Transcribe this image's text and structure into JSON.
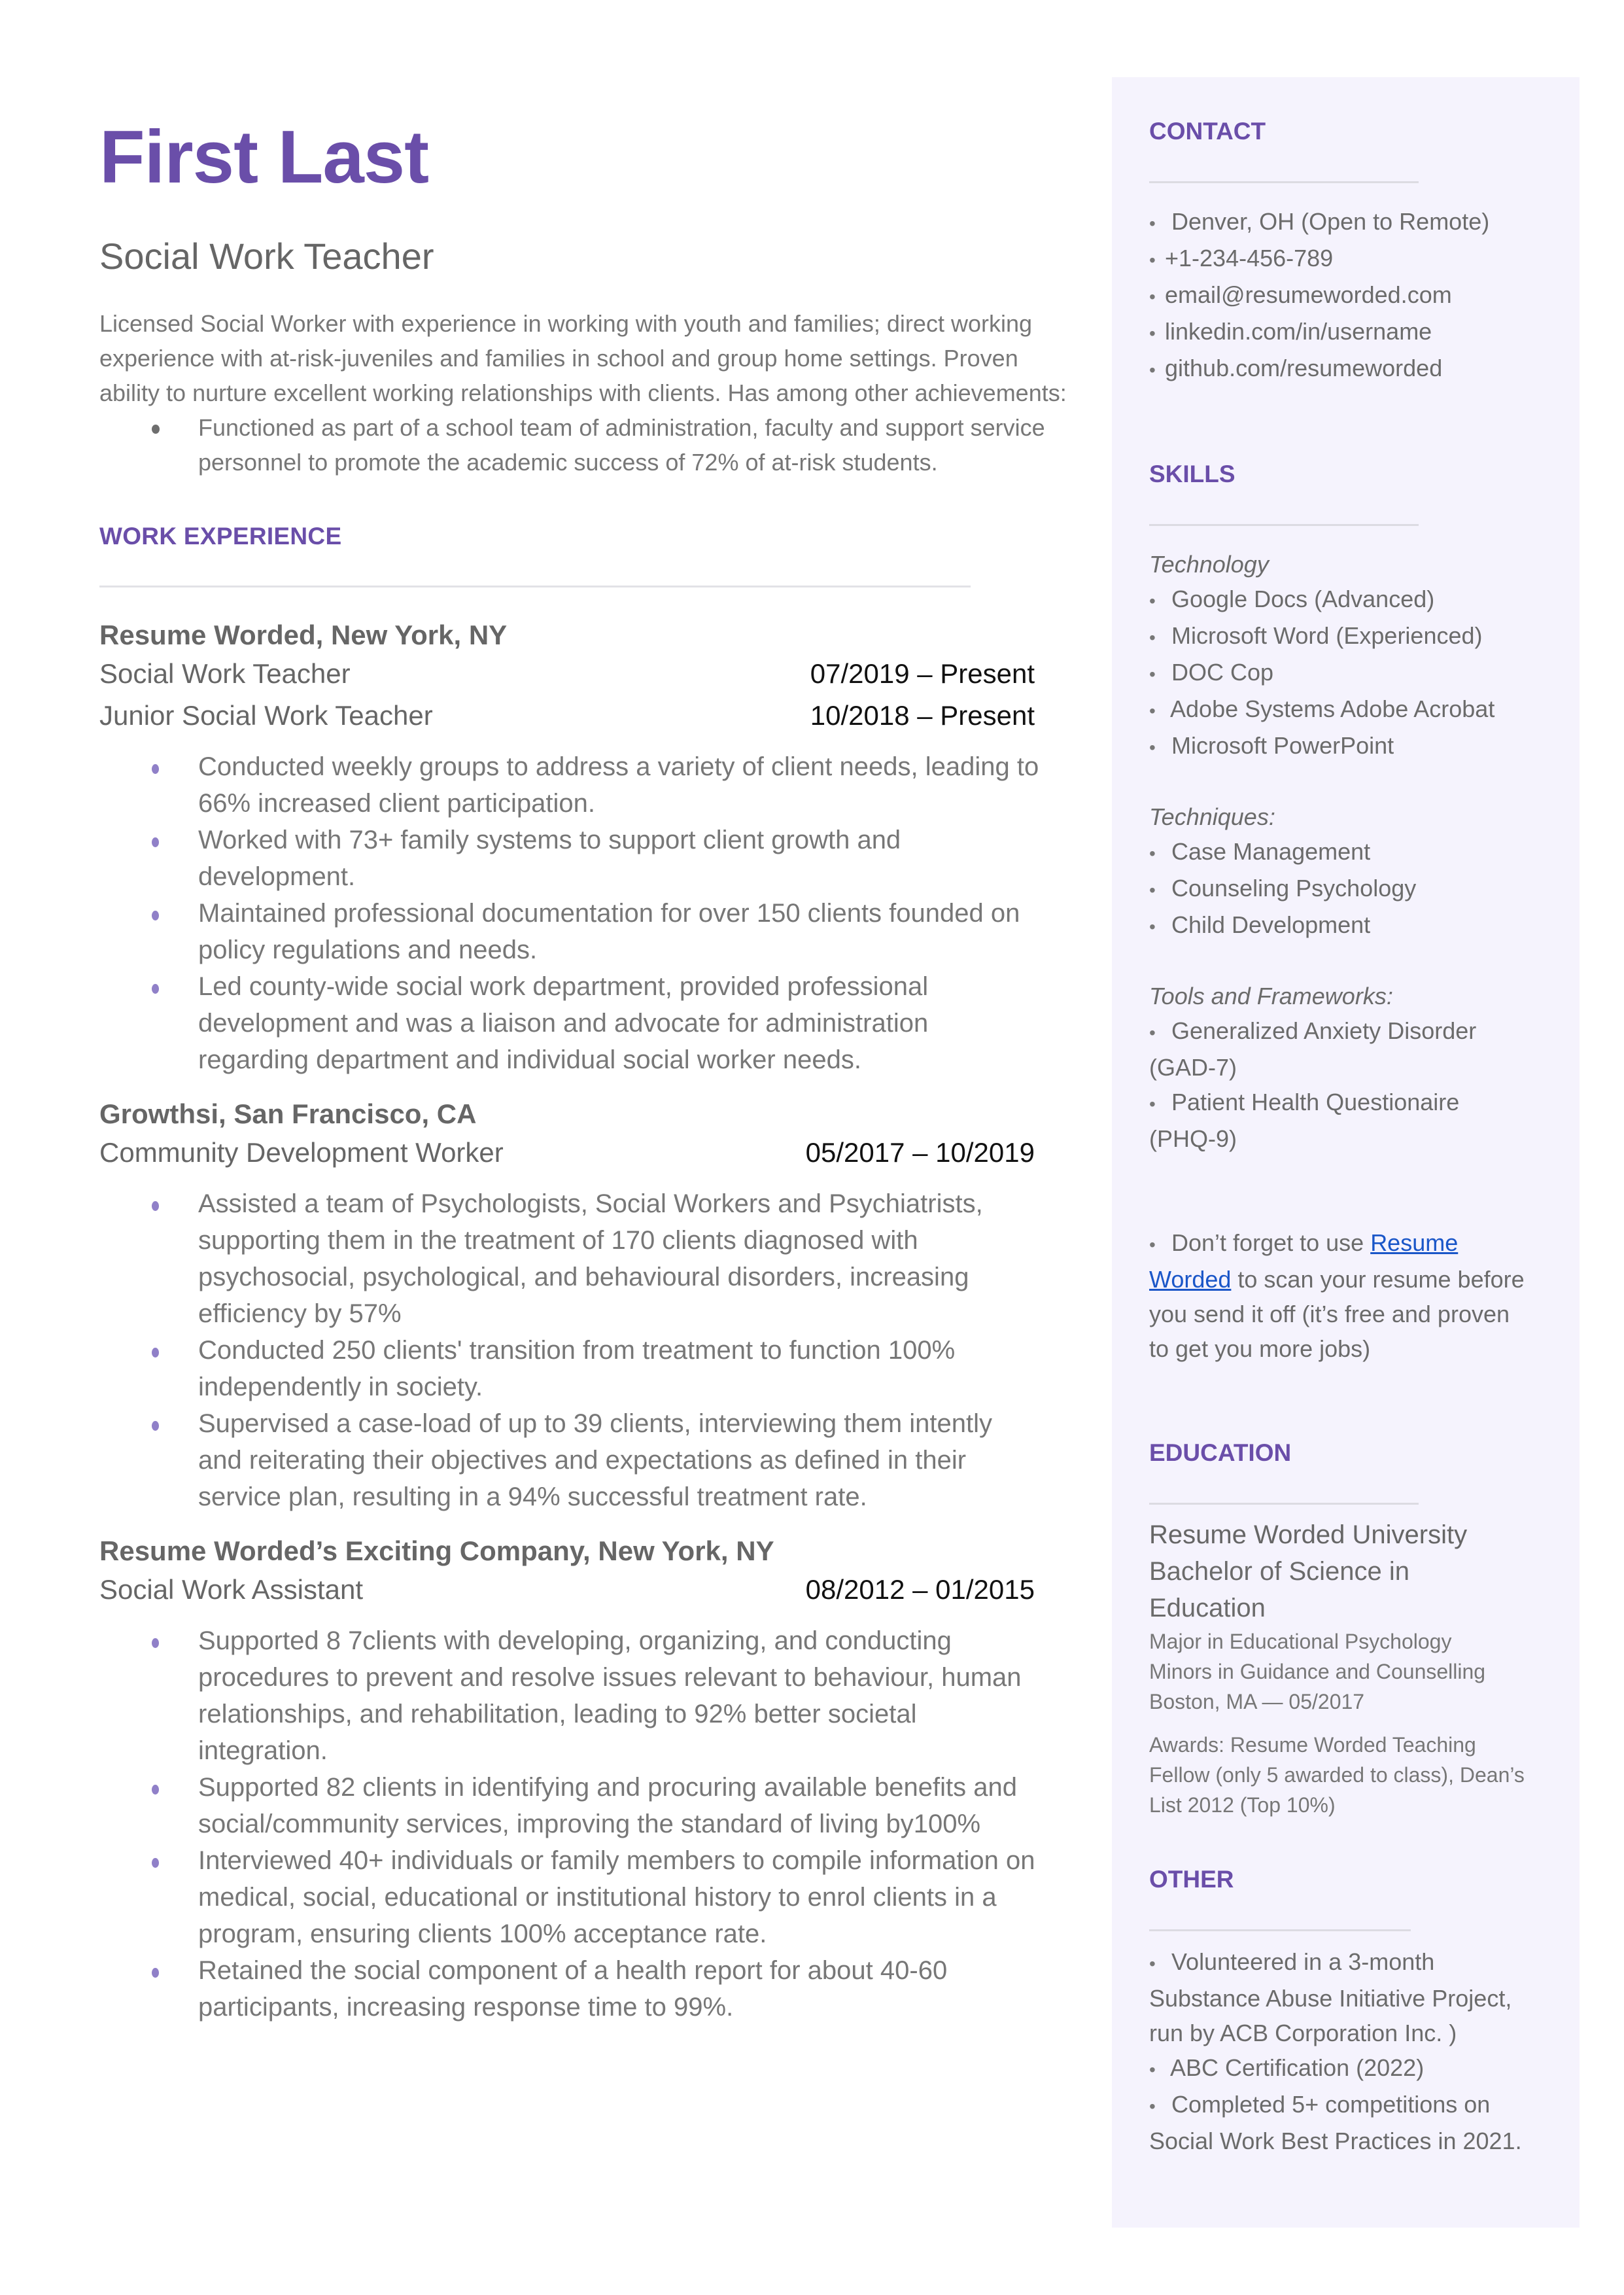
{
  "header": {
    "name": "First Last",
    "headline": "Social Work Teacher",
    "summary": "Licensed Social Worker with experience in working with youth and families; direct working experience with at-risk-juveniles and families in school and group home settings. Proven ability to nurture excellent working relationships with clients. Has among other achievements:",
    "summary_bullets": [
      "Functioned as part of a school team of administration, faculty and support service personnel to promote the academic success of 72% of at-risk students."
    ]
  },
  "work_experience": {
    "title": "WORK EXPERIENCE",
    "jobs": [
      {
        "company": "Resume Worded, New York, NY",
        "roles": [
          {
            "title": "Social Work Teacher",
            "dates": "07/2019 – Present"
          },
          {
            "title": "Junior Social Work Teacher",
            "dates": "10/2018 – Present"
          }
        ],
        "bullets": [
          "Conducted weekly groups to address a variety of client needs, leading to 66% increased client participation.",
          "Worked with 73+ family systems to support client growth and development.",
          "Maintained professional documentation for over 150 clients founded on policy regulations and needs.",
          "Led county-wide social work department, provided professional development and was a liaison and advocate for administration regarding department and individual social worker needs."
        ]
      },
      {
        "company": "Growthsi, San Francisco, CA",
        "roles": [
          {
            "title": "Community Development Worker",
            "dates": "05/2017 – 10/2019"
          }
        ],
        "bullets": [
          "Assisted a team of Psychologists, Social Workers and Psychiatrists, supporting them in the treatment of 170 clients diagnosed with psychosocial, psychological, and behavioural disorders, increasing efficiency by 57%",
          "Conducted 250 clients' transition from treatment to function 100% independently in society.",
          "Supervised a case-load of up to 39 clients, interviewing them intently and reiterating their objectives and expectations as defined in their service plan, resulting in a 94% successful treatment rate."
        ]
      },
      {
        "company": "Resume Worded’s Exciting Company, New York, NY",
        "roles": [
          {
            "title": "Social Work Assistant",
            "dates": "08/2012 – 01/2015"
          }
        ],
        "bullets": [
          "Supported 8 7clients with developing, organizing, and conducting procedures to prevent and resolve issues relevant to behaviour, human relationships, and rehabilitation, leading to 92% better societal integration.",
          "Supported 82 clients in identifying and procuring available benefits and social/community services, improving the standard of living by100%",
          "Interviewed 40+ individuals or family members to compile information on medical, social, educational or institutional history to enrol clients in a program, ensuring clients 100% acceptance rate.",
          "Retained the social component of a health report for about 40-60 participants, increasing response time to 99%."
        ]
      }
    ]
  },
  "sidebar": {
    "contact": {
      "title": "CONTACT",
      "items": [
        "Denver, OH (Open to Remote)",
        "+1-234-456-789",
        "email@resumeworded.com",
        "linkedin.com/in/username",
        "github.com/resumeworded"
      ]
    },
    "skills": {
      "title": "SKILLS",
      "categories": [
        {
          "label": "Technology",
          "items": [
            "Google Docs (Advanced)",
            "Microsoft Word (Experienced)",
            "DOC Cop",
            "Adobe Systems Adobe Acrobat",
            "Microsoft PowerPoint"
          ]
        },
        {
          "label": "Techniques:",
          "items": [
            "Case Management",
            "Counseling Psychology",
            "Child Development"
          ]
        },
        {
          "label": "Tools and Frameworks:",
          "items": [
            "Generalized Anxiety Disorder (GAD-7)",
            "Patient Health Questionaire (PHQ-9)"
          ]
        }
      ],
      "tip": {
        "before": "Don’t forget to use ",
        "link": "Resume Worded",
        "after": " to scan your resume before you send it off (it’s free and proven to get you more jobs)"
      }
    },
    "education": {
      "title": "EDUCATION",
      "school": "Resume Worded University",
      "degree": "Bachelor of Science in Education",
      "major": "Major in Educational Psychology",
      "minors": "Minors in Guidance and Counselling",
      "location_date": "Boston, MA — 05/2017",
      "awards": "Awards: Resume Worded Teaching Fellow (only 5 awarded to class), Dean’s List 2012 (Top 10%)"
    },
    "other": {
      "title": "OTHER",
      "items": [
        "Volunteered in a 3-month Substance Abuse Initiative Project, run by ACB Corporation Inc. )",
        "ABC Certification (2022)",
        "Completed 5+ competitions on Social Work Best Practices in 2021."
      ]
    }
  },
  "colors": {
    "accent": "#6a4ea9",
    "bullet": "#9080c8",
    "sidebar_bg": "#f5f3fd",
    "link": "#1a56c8",
    "text": "#666666"
  }
}
